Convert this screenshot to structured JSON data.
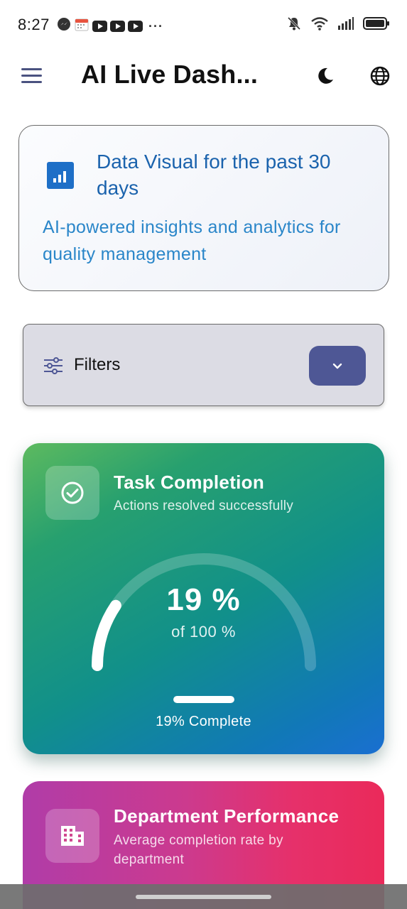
{
  "status_bar": {
    "time": "8:27",
    "left_icons": [
      "messenger-icon",
      "calendar-icon",
      "youtube-icon",
      "youtube-icon",
      "youtube-icon"
    ],
    "more": "···",
    "right_icons": [
      "bell-off-icon",
      "wifi-icon",
      "signal-icon",
      "battery-icon"
    ]
  },
  "app_bar": {
    "title": "AI Live Dash...",
    "menu_icon": "menu-icon",
    "theme_icon": "moon-icon",
    "language_icon": "globe-icon"
  },
  "header_card": {
    "title": "Data Visual for the past 30 days",
    "subtitle": "AI-powered insights and analytics for quality management",
    "icon": "bar-chart-icon",
    "colors": {
      "title": "#1b63ad",
      "subtitle": "#2a86c9",
      "icon_bg": "#1e6fc7"
    }
  },
  "filters": {
    "label": "Filters",
    "icon": "sliders-icon",
    "toggle_icon": "chevron-down-icon",
    "toggle_color": "#4e5795"
  },
  "task_card": {
    "title": "Task Completion",
    "subtitle": "Actions resolved successfully",
    "icon": "check-circle-icon",
    "value_text": "19 %",
    "of_text": "of 100 %",
    "progress": 0.19,
    "progress_label": "19% Complete"
  },
  "dept_card": {
    "title": "Department Performance",
    "subtitle": "Average completion rate by department",
    "icon": "building-icon"
  }
}
